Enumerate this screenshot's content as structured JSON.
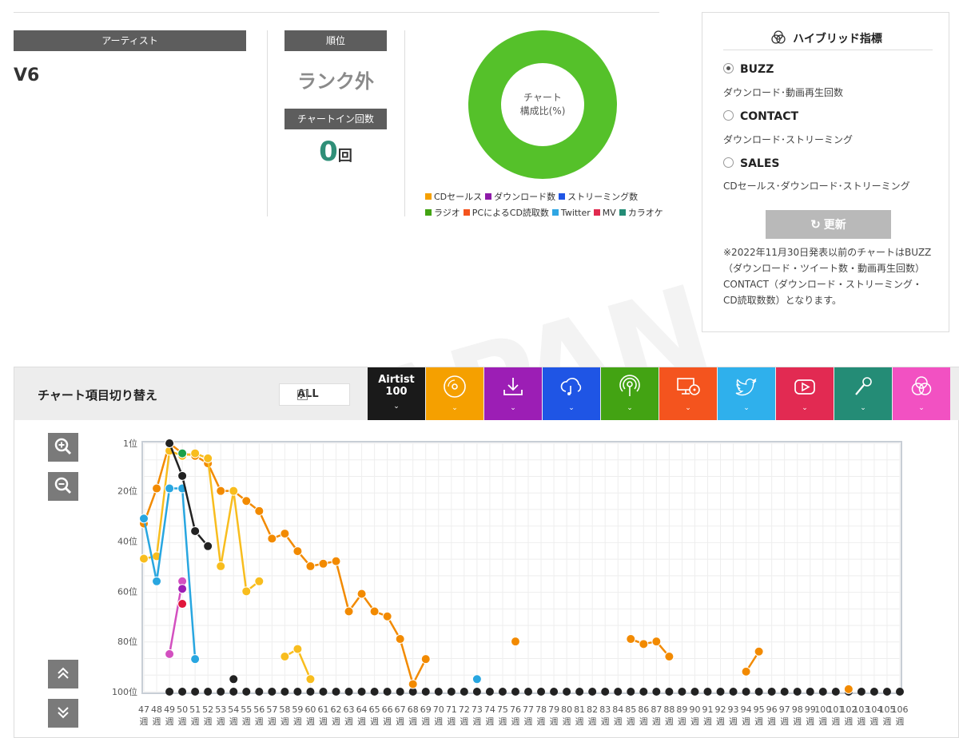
{
  "artist_label": "アーティスト",
  "artist_name": "V6",
  "rank_label": "順位",
  "rank_value": "ランク外",
  "chartin_label": "チャートイン回数",
  "chartin_count": "0",
  "chartin_unit": "回",
  "donut_line1": "チャート",
  "donut_line2": "構成比(%)",
  "legend": [
    {
      "label": "CDセールス",
      "color": "#f5a000"
    },
    {
      "label": "ダウンロード数",
      "color": "#8e1aa8"
    },
    {
      "label": "ストリーミング数",
      "color": "#1f55e5"
    },
    {
      "label": "ラジオ",
      "color": "#43a313"
    },
    {
      "label": "PCによるCD読取数",
      "color": "#f4541e"
    },
    {
      "label": "Twitter",
      "color": "#2fa6e3"
    },
    {
      "label": "MV",
      "color": "#e02a4f"
    },
    {
      "label": "カラオケ",
      "color": "#248c76"
    }
  ],
  "hybrid": {
    "title": "ハイブリッド指標",
    "options": [
      {
        "label": "BUZZ",
        "desc": "ダウンロード･動画再生回数",
        "selected": true
      },
      {
        "label": "CONTACT",
        "desc": "ダウンロード･ストリーミング",
        "selected": false
      },
      {
        "label": "SALES",
        "desc": "CDセールス･ダウンロード･ストリーミング",
        "selected": false
      }
    ],
    "update_label": "更新",
    "note": "※2022年11月30日発表以前のチャートはBUZZ（ダウンロード・ツイート数・動画再生回数）CONTACT（ダウンロード・ストリーミング・CD読取数数）となります。"
  },
  "chart_toolbar": {
    "title": "チャート項目切り替え",
    "all_label": "ALL",
    "airtist_line1": "Airtist",
    "airtist_line2": "100",
    "categories": [
      {
        "icon": "cd-icon",
        "color": "#f5a000"
      },
      {
        "icon": "download-icon",
        "color": "#9c1eb5"
      },
      {
        "icon": "streaming-cloud-icon",
        "color": "#1f55e5"
      },
      {
        "icon": "radio-icon",
        "color": "#43a313"
      },
      {
        "icon": "pc-cd-icon",
        "color": "#f4541e"
      },
      {
        "icon": "twitter-icon",
        "color": "#2fb0ec"
      },
      {
        "icon": "youtube-icon",
        "color": "#e22a52"
      },
      {
        "icon": "karaoke-icon",
        "color": "#248c76"
      },
      {
        "icon": "hybrid-icon",
        "color": "#f251c2"
      }
    ]
  },
  "chart_data": {
    "type": "line",
    "y_ticks": [
      "1位",
      "20位",
      "40位",
      "60位",
      "80位",
      "100位"
    ],
    "ylim": [
      100,
      1
    ],
    "x": [
      "47週",
      "48週",
      "49週",
      "50週",
      "51週",
      "52週",
      "53週",
      "54週",
      "55週",
      "56週",
      "57週",
      "58週",
      "59週",
      "60週",
      "61週",
      "62週",
      "63週",
      "64週",
      "65週",
      "66週",
      "67週",
      "68週",
      "69週",
      "70週",
      "71週",
      "72週",
      "73週",
      "74週",
      "75週",
      "76週",
      "77週",
      "78週",
      "79週",
      "80週",
      "81週",
      "82週",
      "83週",
      "84週",
      "85週",
      "86週",
      "87週",
      "88週",
      "89週",
      "90週",
      "91週",
      "92週",
      "93週",
      "94週",
      "95週",
      "96週",
      "97週",
      "98週",
      "99週",
      "100週",
      "101週",
      "102週",
      "103週",
      "104週",
      "105週",
      "106週"
    ],
    "series": [
      {
        "color": "#f28a00",
        "values": [
          33,
          19,
          1,
          5,
          6,
          9,
          20,
          20,
          24,
          28,
          39,
          37,
          44,
          50,
          49,
          48,
          68,
          61,
          68,
          70,
          79,
          97,
          87,
          null,
          null,
          null,
          null,
          null,
          null,
          80,
          null,
          null,
          null,
          null,
          null,
          null,
          null,
          null,
          79,
          81,
          80,
          86,
          null,
          null,
          null,
          null,
          null,
          92,
          84,
          null,
          null,
          null,
          null,
          null,
          null,
          99,
          null,
          null,
          null,
          null
        ]
      },
      {
        "color": "#f8bd1e",
        "values": [
          47,
          46,
          4,
          6,
          5,
          7,
          50,
          20,
          60,
          56,
          null,
          86,
          83,
          95,
          null,
          null,
          null,
          null,
          null,
          null,
          null,
          null,
          null,
          null,
          null,
          null,
          null,
          null,
          null,
          null,
          null,
          null,
          null,
          null,
          null,
          null,
          null,
          null,
          null,
          null,
          null,
          null,
          null,
          null,
          null,
          null,
          null,
          null,
          null,
          null,
          null,
          null,
          null,
          null,
          null,
          null,
          null,
          null,
          null,
          null
        ]
      },
      {
        "color": "#28a6e0",
        "values": [
          31,
          56,
          19,
          19,
          87,
          null,
          null,
          null,
          null,
          null,
          null,
          null,
          null,
          null,
          null,
          null,
          null,
          null,
          null,
          null,
          null,
          null,
          null,
          null,
          null,
          null,
          95,
          null,
          null,
          null,
          null,
          null,
          null,
          null,
          null,
          null,
          null,
          null,
          null,
          null,
          null,
          null,
          null,
          null,
          null,
          null,
          null,
          null,
          null,
          null,
          null,
          null,
          null,
          null,
          null,
          null,
          null,
          null,
          null,
          null
        ]
      },
      {
        "color": "#222222",
        "values": [
          null,
          null,
          1,
          14,
          36,
          42,
          null,
          95,
          null,
          null,
          null,
          null,
          null,
          null,
          null,
          null,
          null,
          null,
          null,
          null,
          null,
          null,
          null,
          null,
          null,
          null,
          null,
          null,
          null,
          null,
          null,
          null,
          null,
          null,
          null,
          null,
          null,
          null,
          null,
          null,
          null,
          null,
          null,
          null,
          null,
          null,
          null,
          null,
          null,
          null,
          null,
          null,
          null,
          null,
          null,
          null,
          null,
          null,
          null,
          null
        ]
      },
      {
        "color": "#d350c0",
        "values": [
          null,
          null,
          85,
          56,
          null,
          null,
          null,
          null,
          null,
          null,
          null,
          null,
          null,
          null,
          null,
          null,
          null,
          null,
          null,
          null,
          null,
          null,
          null,
          null,
          null,
          null,
          null,
          null,
          null,
          null,
          null,
          null,
          null,
          null,
          null,
          null,
          null,
          null,
          null,
          null,
          null,
          null,
          null,
          null,
          null,
          null,
          null,
          null,
          null,
          null,
          null,
          null,
          null,
          null,
          null,
          null,
          null,
          null,
          null,
          null
        ]
      },
      {
        "color": "#9c1eb5",
        "values": [
          null,
          null,
          null,
          59,
          null,
          null,
          null,
          null,
          null,
          null,
          null,
          null,
          null,
          null,
          null,
          null,
          null,
          null,
          null,
          null,
          null,
          null,
          null,
          null,
          null,
          null,
          null,
          null,
          null,
          null,
          null,
          null,
          null,
          null,
          null,
          null,
          null,
          null,
          null,
          null,
          null,
          null,
          null,
          null,
          null,
          null,
          null,
          null,
          null,
          null,
          null,
          null,
          null,
          null,
          null,
          null,
          null,
          null,
          null,
          null
        ]
      },
      {
        "color": "#e0153a",
        "values": [
          null,
          null,
          null,
          65,
          null,
          null,
          null,
          null,
          null,
          null,
          null,
          null,
          null,
          null,
          null,
          null,
          null,
          null,
          null,
          null,
          null,
          null,
          null,
          null,
          null,
          null,
          null,
          null,
          null,
          null,
          null,
          null,
          null,
          null,
          null,
          null,
          null,
          null,
          null,
          null,
          null,
          null,
          null,
          null,
          null,
          null,
          null,
          null,
          null,
          null,
          null,
          null,
          null,
          null,
          null,
          null,
          null,
          null,
          null,
          null
        ]
      },
      {
        "color": "#1ba04a",
        "values": [
          null,
          null,
          null,
          5,
          null,
          null,
          null,
          null,
          null,
          null,
          null,
          null,
          null,
          null,
          null,
          null,
          null,
          null,
          null,
          null,
          null,
          null,
          null,
          null,
          null,
          null,
          null,
          null,
          null,
          null,
          null,
          null,
          null,
          null,
          null,
          null,
          null,
          null,
          null,
          null,
          null,
          null,
          null,
          null,
          null,
          null,
          null,
          null,
          null,
          null,
          null,
          null,
          null,
          null,
          null,
          null,
          null,
          null,
          null,
          null
        ]
      }
    ],
    "grid": true,
    "legend": "none"
  }
}
